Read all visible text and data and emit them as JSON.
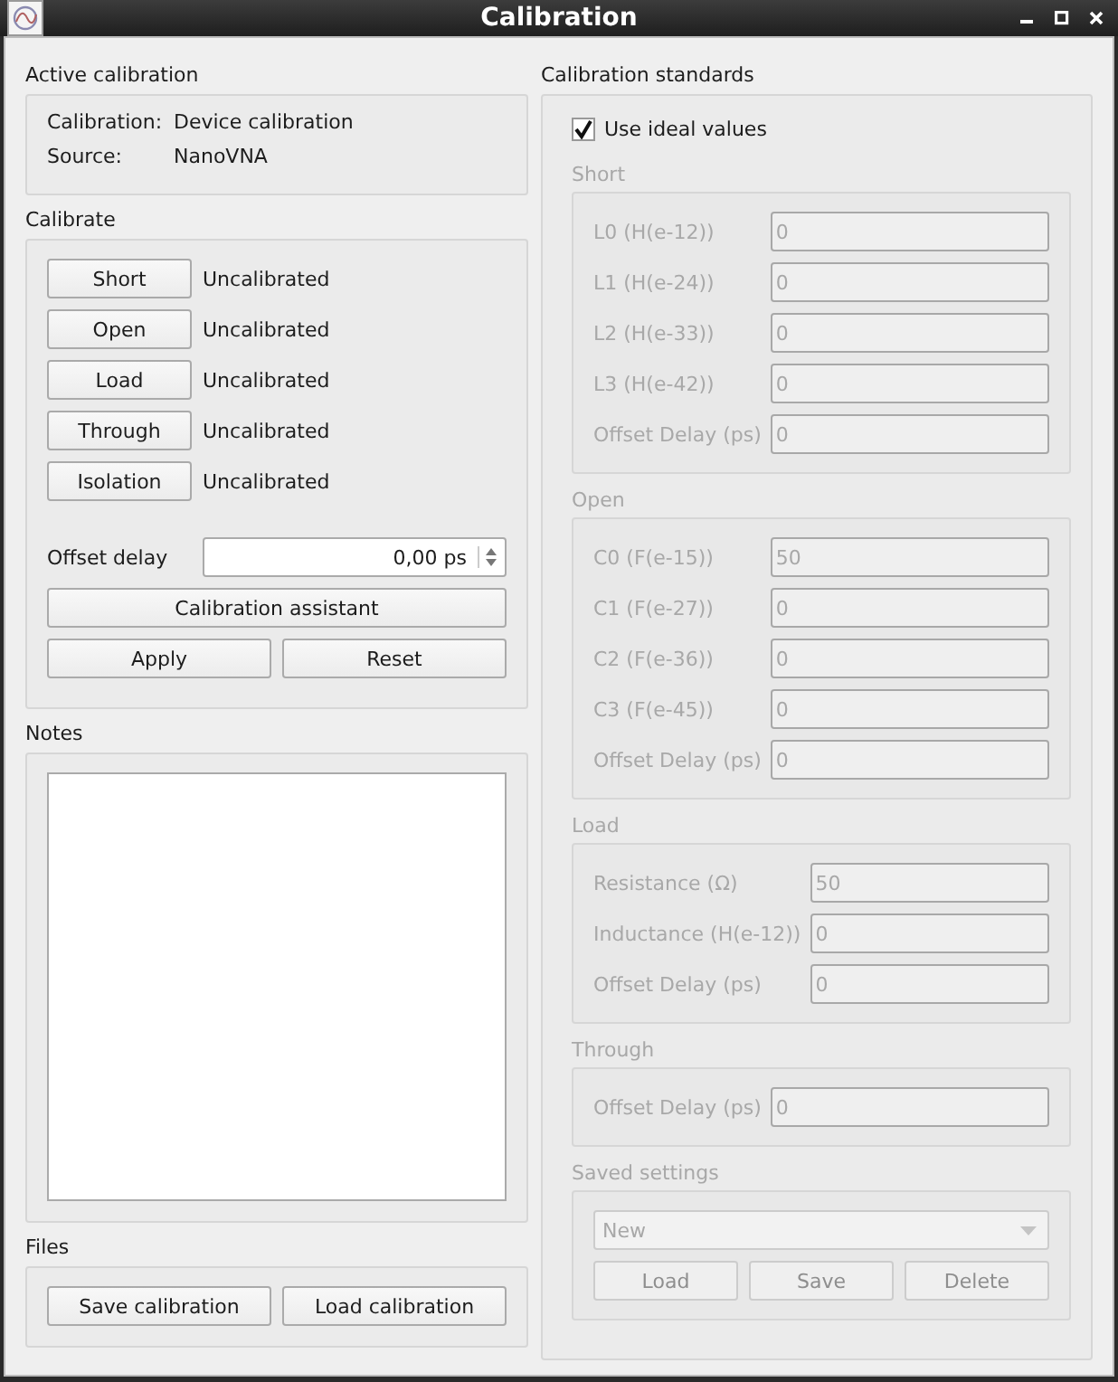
{
  "window": {
    "title": "Calibration"
  },
  "active_calibration": {
    "title": "Active calibration",
    "rows": [
      {
        "label": "Calibration:",
        "value": "Device calibration"
      },
      {
        "label": "Source:",
        "value": "NanoVNA"
      }
    ]
  },
  "calibrate": {
    "title": "Calibrate",
    "standards": [
      {
        "button": "Short",
        "status": "Uncalibrated"
      },
      {
        "button": "Open",
        "status": "Uncalibrated"
      },
      {
        "button": "Load",
        "status": "Uncalibrated"
      },
      {
        "button": "Through",
        "status": "Uncalibrated"
      },
      {
        "button": "Isolation",
        "status": "Uncalibrated"
      }
    ],
    "offset_delay": {
      "label": "Offset delay",
      "value": "0,00 ps"
    },
    "assistant_button": "Calibration assistant",
    "buttons": [
      "Apply",
      "Reset"
    ]
  },
  "notes": {
    "title": "Notes"
  },
  "files": {
    "title": "Files",
    "buttons": [
      "Save calibration",
      "Load calibration"
    ]
  },
  "calibration_standards": {
    "title": "Calibration standards",
    "use_ideal_values": {
      "label": "Use ideal values",
      "checked": true
    },
    "groups": [
      {
        "title": "Short",
        "fields": [
          {
            "label": "L0 (H(e-12))",
            "value": "0"
          },
          {
            "label": "L1 (H(e-24))",
            "value": "0"
          },
          {
            "label": "L2 (H(e-33))",
            "value": "0"
          },
          {
            "label": "L3 (H(e-42))",
            "value": "0"
          },
          {
            "label": "Offset Delay (ps)",
            "value": "0"
          }
        ]
      },
      {
        "title": "Open",
        "fields": [
          {
            "label": "C0 (F(e-15))",
            "value": "50"
          },
          {
            "label": "C1 (F(e-27))",
            "value": "0"
          },
          {
            "label": "C2 (F(e-36))",
            "value": "0"
          },
          {
            "label": "C3 (F(e-45))",
            "value": "0"
          },
          {
            "label": "Offset Delay (ps)",
            "value": "0"
          }
        ]
      },
      {
        "title": "Load",
        "fields": [
          {
            "label": "Resistance (Ω)",
            "value": "50"
          },
          {
            "label": "Inductance (H(e-12))",
            "value": "0"
          },
          {
            "label": "Offset Delay (ps)",
            "value": "0"
          }
        ]
      },
      {
        "title": "Through",
        "fields": [
          {
            "label": "Offset Delay (ps)",
            "value": "0"
          }
        ]
      }
    ],
    "saved_settings": {
      "title": "Saved settings",
      "dropdown": "New",
      "buttons": [
        "Load",
        "Save",
        "Delete"
      ]
    }
  }
}
